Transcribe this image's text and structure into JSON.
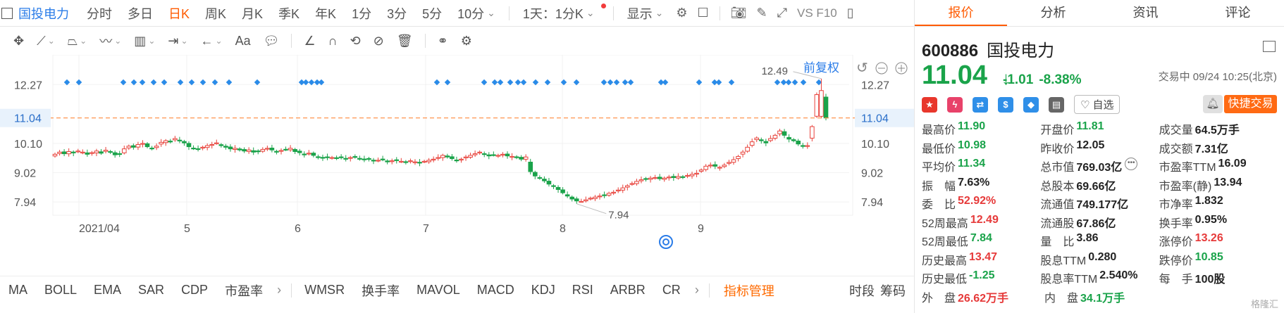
{
  "topbar": {
    "stock_name": "国投电力",
    "periods": [
      "分时",
      "多日",
      "日K",
      "周K",
      "月K",
      "季K",
      "年K",
      "1分",
      "3分",
      "5分",
      "10分"
    ],
    "active_period": "日K",
    "interval_select": "1天：1分K",
    "display_label": "显示",
    "vs_label": "VS F10"
  },
  "panel": {
    "tabs": [
      "报价",
      "分析",
      "资讯",
      "评论"
    ],
    "active_tab": "报价",
    "code": "600886",
    "name": "国投电力",
    "price": "11.04",
    "change": "-1.01",
    "change_pct": "-8.38%",
    "status": "交易中 09/24 10:25(北京)",
    "watch_label": "自选",
    "trade_label": "快捷交易",
    "badge_icons": [
      {
        "name": "cn-flag-icon",
        "color": "#e8372c",
        "glyph": "★"
      },
      {
        "name": "lightning-icon",
        "color": "#e8426a",
        "glyph": "ϟ"
      },
      {
        "name": "shuffle-icon",
        "color": "#2f8fe8",
        "glyph": "⇄"
      },
      {
        "name": "dollar-icon",
        "color": "#2f8fe8",
        "glyph": "$"
      },
      {
        "name": "tag-icon",
        "color": "#2f8fe8",
        "glyph": "◆"
      },
      {
        "name": "notebook-icon",
        "color": "#666666",
        "glyph": "▤"
      }
    ],
    "quotes": [
      [
        {
          "k": "最高价",
          "v": "11.90",
          "c": "dn"
        },
        {
          "k": "开盘价",
          "v": "11.81",
          "c": "dn"
        },
        {
          "k": "成交量",
          "v": "64.5万手",
          "c": "nt"
        }
      ],
      [
        {
          "k": "最低价",
          "v": "10.98",
          "c": "dn"
        },
        {
          "k": "昨收价",
          "v": "12.05",
          "c": "nt"
        },
        {
          "k": "成交额",
          "v": "7.31亿",
          "c": "nt"
        }
      ],
      [
        {
          "k": "平均价",
          "v": "11.34",
          "c": "dn"
        },
        {
          "k": "总市值",
          "v": "769.03亿",
          "c": "nt"
        },
        {
          "k": "市盈率TTM",
          "v": "16.09",
          "c": "nt"
        }
      ],
      [
        {
          "k": "振　幅",
          "v": "7.63%",
          "c": "nt"
        },
        {
          "k": "总股本",
          "v": "69.66亿",
          "c": "nt"
        },
        {
          "k": "市盈率(静)",
          "v": "13.94",
          "c": "nt"
        }
      ],
      [
        {
          "k": "委　比",
          "v": "52.92%",
          "c": "up"
        },
        {
          "k": "流通值",
          "v": "749.177亿",
          "c": "nt"
        },
        {
          "k": "市净率",
          "v": "1.832",
          "c": "nt"
        }
      ],
      [
        {
          "k": "52周最高",
          "v": "12.49",
          "c": "up"
        },
        {
          "k": "流通股",
          "v": "67.86亿",
          "c": "nt"
        },
        {
          "k": "换手率",
          "v": "0.95%",
          "c": "nt"
        }
      ],
      [
        {
          "k": "52周最低",
          "v": "7.84",
          "c": "dn"
        },
        {
          "k": "量　比",
          "v": "3.86",
          "c": "nt"
        },
        {
          "k": "涨停价",
          "v": "13.26",
          "c": "up"
        }
      ],
      [
        {
          "k": "历史最高",
          "v": "13.47",
          "c": "up"
        },
        {
          "k": "股息TTM",
          "v": "0.280",
          "c": "nt"
        },
        {
          "k": "跌停价",
          "v": "10.85",
          "c": "dn"
        }
      ],
      [
        {
          "k": "历史最低",
          "v": "-1.25",
          "c": "dn"
        },
        {
          "k": "股息率TTM",
          "v": "2.540%",
          "c": "nt"
        },
        {
          "k": "每　手",
          "v": "100股",
          "c": "nt"
        }
      ],
      [
        {
          "k": "外　盘",
          "v": "26.62万手",
          "c": "up"
        },
        {
          "k": "内　盘",
          "v": "34.1万手",
          "c": "dn"
        }
      ]
    ],
    "watermark": "格隆汇"
  },
  "chart_labels": {
    "restore": "前复权",
    "high_label": "12.49",
    "low_label": "7.94",
    "current_price": "11.04",
    "y_ticks": [
      "12.27",
      "11.04",
      "10.10",
      "9.02",
      "7.94"
    ],
    "x_ticks": [
      "2021/04",
      "5",
      "6",
      "7",
      "8",
      "9"
    ]
  },
  "indicators": {
    "left": [
      "MA",
      "BOLL",
      "EMA",
      "SAR",
      "CDP",
      "市盈率"
    ],
    "right": [
      "WMSR",
      "换手率",
      "MAVOL",
      "MACD",
      "KDJ",
      "RSI",
      "ARBR",
      "CR"
    ],
    "manage": "指标管理",
    "extra": [
      "时段",
      "筹码"
    ]
  },
  "chart_data": {
    "type": "candlestick",
    "y_ticks": [
      12.27,
      11.04,
      10.1,
      9.02,
      7.94
    ],
    "ylim": [
      7.4,
      12.9
    ],
    "current_price": 11.04,
    "high_marker": 12.49,
    "low_marker": 7.94,
    "x_ticks": [
      "2021/04",
      "5",
      "6",
      "7",
      "8",
      "9"
    ],
    "closes": [
      9.7,
      9.78,
      9.72,
      9.8,
      9.75,
      9.82,
      9.78,
      9.7,
      9.76,
      9.82,
      9.74,
      9.85,
      9.8,
      9.68,
      9.72,
      9.9,
      10.0,
      9.96,
      10.06,
      10.1,
      9.98,
      9.92,
      10.0,
      10.14,
      10.2,
      10.16,
      10.28,
      10.2,
      10.12,
      9.98,
      9.92,
      9.88,
      9.96,
      10.02,
      10.06,
      10.12,
      10.02,
      9.96,
      9.9,
      9.92,
      9.86,
      9.82,
      9.86,
      9.78,
      9.82,
      9.88,
      9.92,
      9.86,
      9.8,
      9.84,
      9.88,
      9.92,
      9.8,
      9.76,
      9.7,
      9.74,
      9.66,
      9.6,
      9.56,
      9.6,
      9.58,
      9.56,
      9.6,
      9.54,
      9.58,
      9.6,
      9.54,
      9.5,
      9.54,
      9.46,
      9.48,
      9.52,
      9.42,
      9.46,
      9.48,
      9.44,
      9.4,
      9.46,
      9.42,
      9.38,
      9.44,
      9.48,
      9.52,
      9.58,
      9.66,
      9.6,
      9.54,
      9.48,
      9.52,
      9.6,
      9.66,
      9.72,
      9.78,
      9.7,
      9.64,
      9.68,
      9.66,
      9.7,
      9.64,
      9.62,
      9.58,
      9.52,
      9.6,
      9.06,
      8.9,
      8.82,
      8.72,
      8.6,
      8.52,
      8.4,
      8.28,
      8.16,
      8.05,
      7.98,
      7.96,
      8.02,
      8.08,
      8.12,
      8.16,
      8.2,
      8.26,
      8.3,
      8.38,
      8.46,
      8.54,
      8.62,
      8.7,
      8.76,
      8.8,
      8.82,
      8.84,
      8.8,
      8.82,
      8.86,
      8.84,
      8.88,
      8.86,
      8.92,
      8.96,
      9.0,
      9.12,
      9.26,
      9.3,
      9.26,
      9.22,
      9.3,
      9.4,
      9.5,
      9.62,
      9.78,
      9.96,
      10.16,
      10.3,
      10.2,
      10.12,
      10.28,
      10.4,
      10.56,
      10.4,
      10.26,
      10.2,
      10.08,
      10.0,
      10.02,
      10.72,
      11.9,
      12.05,
      11.04
    ]
  }
}
